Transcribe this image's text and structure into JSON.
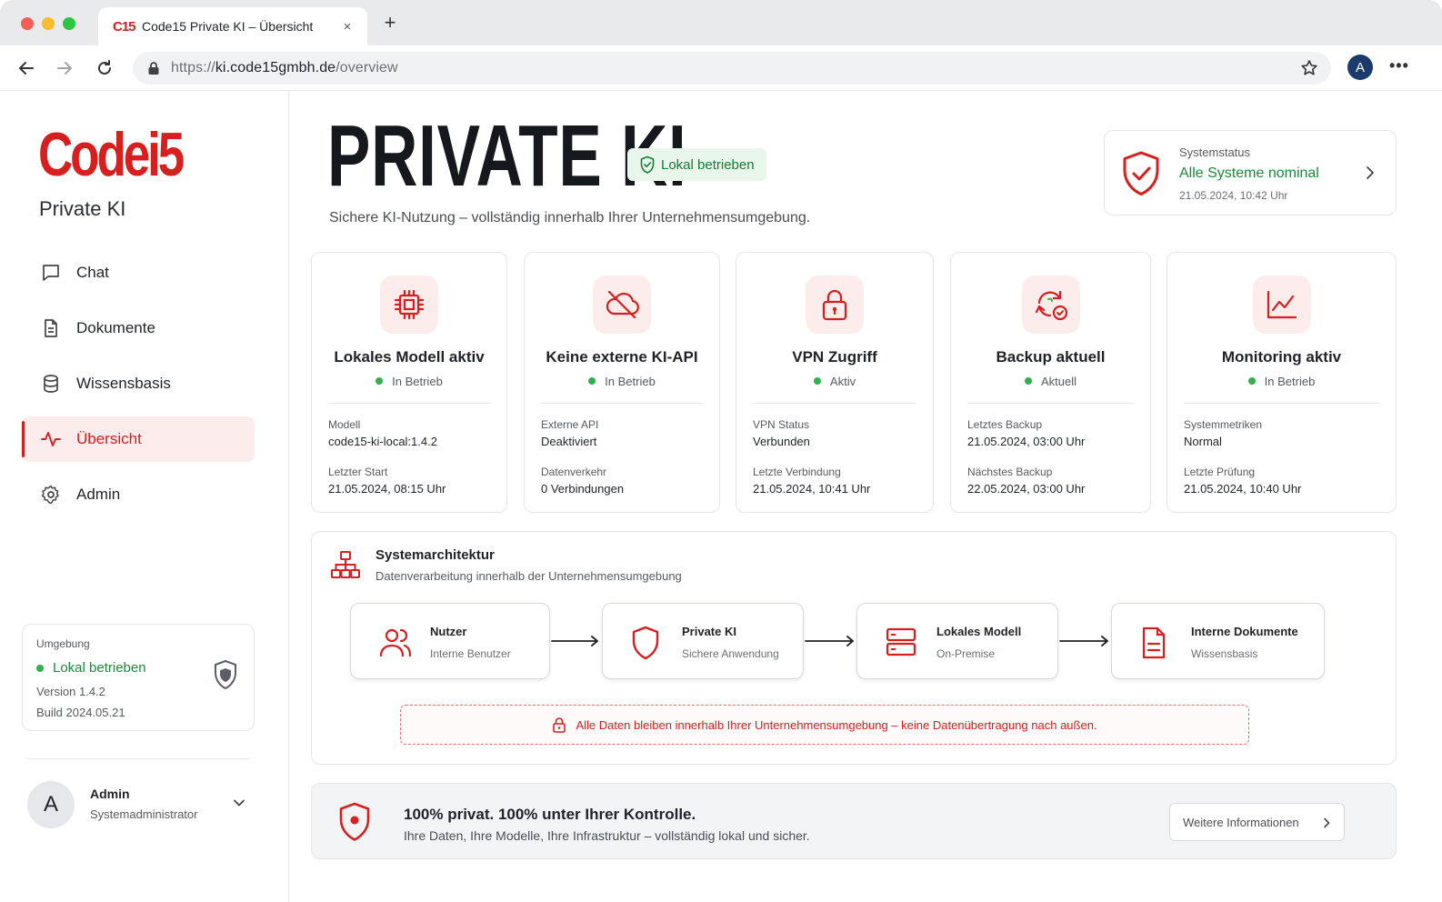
{
  "browser": {
    "tab_favicon": "C15",
    "tab_title": "Code15 Private KI – Übersicht",
    "url_scheme": "https://",
    "url_host": "ki.code15gmbh.de",
    "url_path": "/overview",
    "profile_initial": "A",
    "new_tab": "+",
    "close": "×"
  },
  "sidebar": {
    "logo": "Codei5",
    "subtitle": "Private KI",
    "items": [
      {
        "label": "Chat",
        "icon": "chat-icon"
      },
      {
        "label": "Dokumente",
        "icon": "document-icon"
      },
      {
        "label": "Wissensbasis",
        "icon": "database-icon"
      },
      {
        "label": "Übersicht",
        "icon": "activity-icon",
        "active": true
      },
      {
        "label": "Admin",
        "icon": "gear-icon"
      }
    ],
    "env": {
      "label": "Umgebung",
      "status": "Lokal betrieben",
      "version": "Version 1.4.2",
      "build": "Build 2024.05.21"
    },
    "user": {
      "initial": "A",
      "name": "Admin",
      "role": "Systemadministrator"
    }
  },
  "hero": {
    "title": "PRIVATE KI",
    "badge": "Lokal betrieben",
    "subtitle": "Sichere KI-Nutzung – vollständig innerhalb Ihrer Unternehmensumgebung."
  },
  "system_status": {
    "label": "Systemstatus",
    "value": "Alle Systeme nominal",
    "time": "21.05.2024, 10:42 Uhr"
  },
  "cards": [
    {
      "title": "Lokales Modell aktiv",
      "state": "In Betrieb",
      "k1": "Modell",
      "v1": "code15-ki-local:1.4.2",
      "k2": "Letzter Start",
      "v2": "21.05.2024, 08:15 Uhr",
      "icon": "chip-icon"
    },
    {
      "title": "Keine externe KI-API",
      "state": "In Betrieb",
      "k1": "Externe API",
      "v1": "Deaktiviert",
      "k2": "Datenverkehr",
      "v2": "0 Verbindungen",
      "icon": "cloud-off-icon"
    },
    {
      "title": "VPN Zugriff",
      "state": "Aktiv",
      "k1": "VPN Status",
      "v1": "Verbunden",
      "k2": "Letzte Verbindung",
      "v2": "21.05.2024, 10:41 Uhr",
      "icon": "lock-icon"
    },
    {
      "title": "Backup aktuell",
      "state": "Aktuell",
      "k1": "Letztes Backup",
      "v1": "21.05.2024, 03:00 Uhr",
      "k2": "Nächstes Backup",
      "v2": "22.05.2024, 03:00 Uhr",
      "icon": "backup-icon"
    },
    {
      "title": "Monitoring aktiv",
      "state": "In Betrieb",
      "k1": "Systemmetriken",
      "v1": "Normal",
      "k2": "Letzte Prüfung",
      "v2": "21.05.2024, 10:40 Uhr",
      "icon": "chart-line-icon"
    }
  ],
  "architecture": {
    "title": "Systemarchitektur",
    "subtitle": "Datenverarbeitung innerhalb der Unternehmensumgebung",
    "nodes": [
      {
        "title": "Nutzer",
        "sub": "Interne Benutzer",
        "icon": "users-icon"
      },
      {
        "title": "Private KI",
        "sub": "Sichere Anwendung",
        "icon": "shield-icon"
      },
      {
        "title": "Lokales Modell",
        "sub": "On-Premise",
        "icon": "server-icon"
      },
      {
        "title": "Interne Dokumente",
        "sub": "Wissensbasis",
        "icon": "document-icon"
      }
    ],
    "notice": "Alle Daten bleiben innerhalb Ihrer Unternehmensumgebung – keine Datenübertragung nach außen."
  },
  "footer": {
    "title": "100% privat. 100% unter Ihrer Kontrolle.",
    "subtitle": "Ihre Daten, Ihre Modelle, Ihre Infrastruktur – vollständig lokal und sicher.",
    "button": "Weitere Informationen"
  },
  "colors": {
    "brand_red": "#d6201f",
    "success_green": "#1a8a3a",
    "icon_bg": "#fdecec"
  }
}
